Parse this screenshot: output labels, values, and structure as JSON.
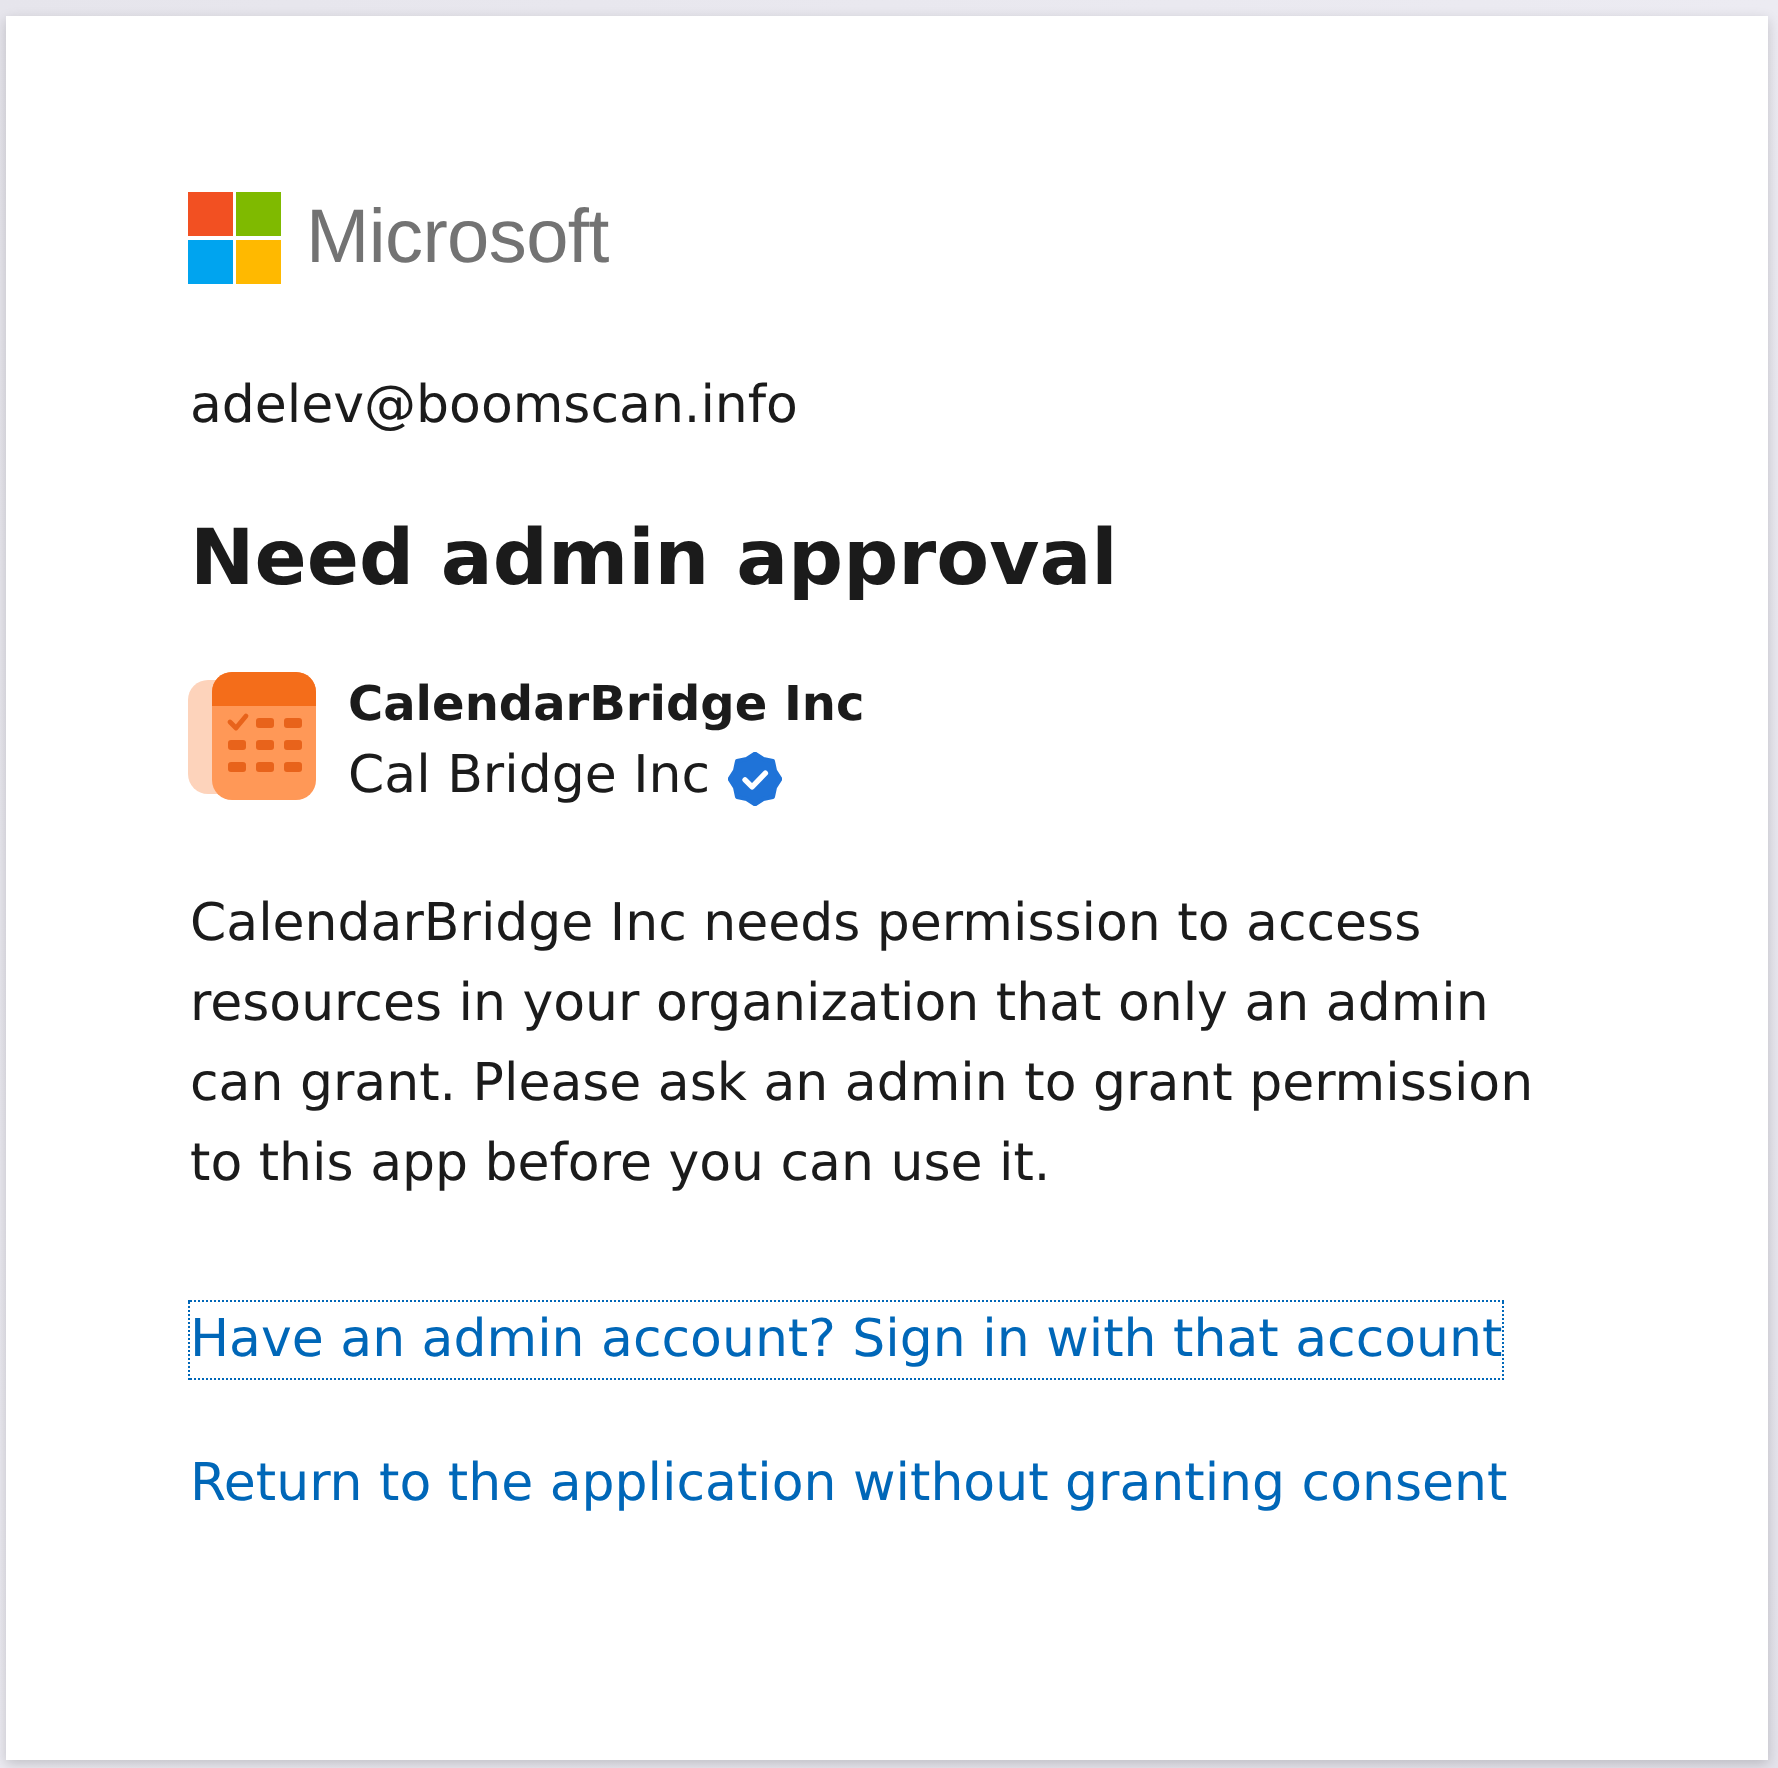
{
  "logo": {
    "brand": "Microsoft"
  },
  "account": {
    "email": "adelev@boomscan.info"
  },
  "title": "Need admin approval",
  "app": {
    "name": "CalendarBridge Inc",
    "publisher": "Cal Bridge Inc",
    "verified": true
  },
  "message": "CalendarBridge Inc needs permission to access resources in your organization that only an admin can grant. Please ask an admin to grant permission to this app before you can use it.",
  "links": [
    {
      "label": "Have an admin account? Sign in with that account",
      "focused": true
    },
    {
      "label": "Return to the application without granting consent",
      "focused": false
    }
  ]
}
